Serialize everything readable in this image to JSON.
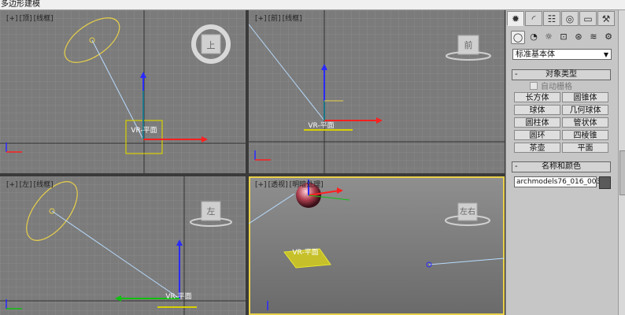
{
  "window": {
    "title": "多边形建模"
  },
  "viewports": {
    "top": {
      "tags": [
        "[+]",
        "[顶]",
        "[线框]"
      ],
      "cube_label": "上",
      "object_label": "VR-平面"
    },
    "front": {
      "tags": [
        "[+]",
        "[前]",
        "[线框]"
      ],
      "cube_label": "前",
      "object_label": "VR-平面"
    },
    "left": {
      "tags": [
        "[+]",
        "[左]",
        "[线框]"
      ],
      "cube_label": "左",
      "object_label": "VR-平面"
    },
    "perspective": {
      "tags": [
        "[+]",
        "[透视]",
        "[明暗处理]"
      ],
      "cube_label": "左右",
      "object_label": "VR-平面"
    }
  },
  "command_panel": {
    "tabs": [
      "create-icon",
      "modify-icon",
      "hierarchy-icon",
      "motion-icon",
      "display-icon",
      "utilities-icon"
    ],
    "tab_glyphs": [
      "✹",
      "◜",
      "☷",
      "◎",
      "▭",
      "⚒"
    ],
    "subtab_glyphs": [
      "◯",
      "◔",
      "☼",
      "⊡",
      "⊛",
      "≋",
      "⚙"
    ],
    "dropdown_value": "标准基本体",
    "object_type": {
      "title": "对象类型",
      "autogrid": "自动栅格",
      "buttons": [
        "长方体",
        "圆锥体",
        "球体",
        "几何球体",
        "圆柱体",
        "管状体",
        "圆环",
        "四棱锥",
        "茶壶",
        "平面"
      ]
    },
    "name_color": {
      "title": "名称和颜色",
      "name_value": "archmodels76_016_003",
      "swatch_color": "#5a5a5a"
    }
  },
  "colors": {
    "accent_yellow": "#e8d04a",
    "axis_blue": "#2a2aff",
    "axis_red": "#ff2020",
    "axis_green": "#10c010"
  }
}
